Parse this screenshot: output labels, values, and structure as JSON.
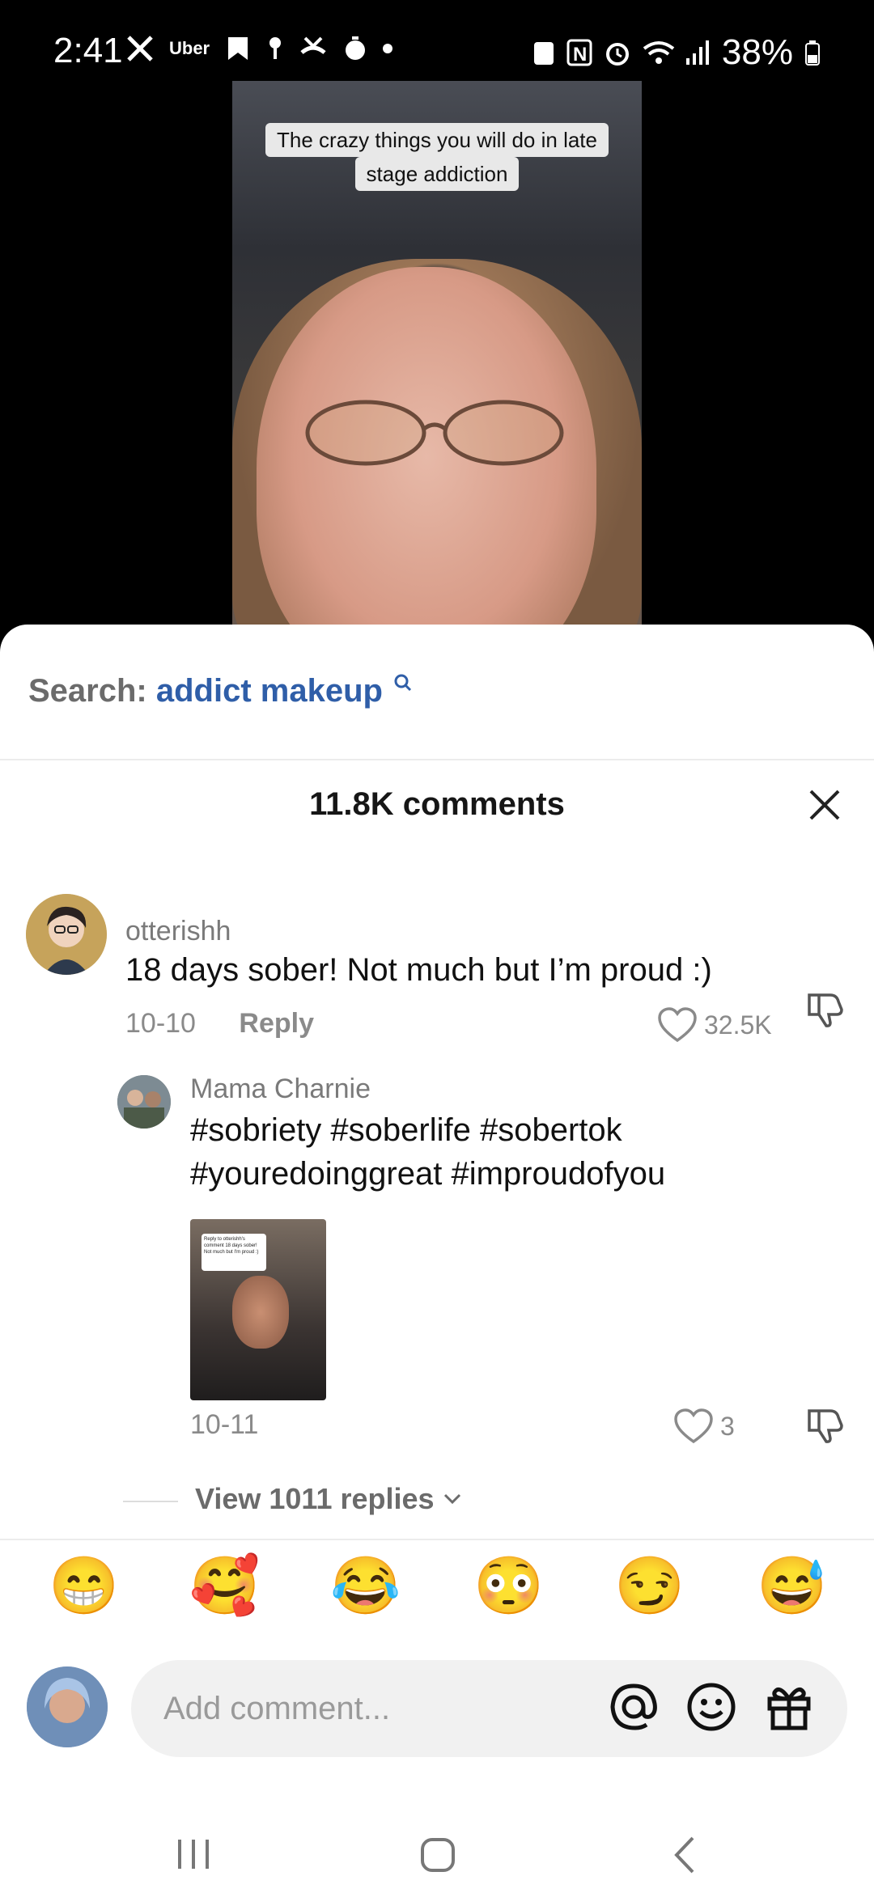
{
  "status_bar": {
    "time": "2:41",
    "uber_label": "Uber",
    "battery": "38%"
  },
  "video": {
    "caption_line1": "The crazy things you will do in late",
    "caption_line2": "stage addiction"
  },
  "search": {
    "label": "Search:",
    "term": "addict makeup"
  },
  "comments": {
    "title": "11.8K comments",
    "main": {
      "username": "otterishh",
      "text": "18 days sober! Not much but I’m proud :)",
      "date": "10-10",
      "reply_label": "Reply",
      "likes": "32.5K"
    },
    "reply": {
      "username": "Mama Charnie",
      "text_line1": "#sobriety #soberlife #sobertok",
      "text_line2": "#youredoinggreat #improudofyou",
      "thumb_caption": "Reply to otterishh's comment 18 days sober! Not much but I'm proud :)",
      "date": "10-11",
      "likes": "3"
    },
    "view_replies": "View 1011 replies"
  },
  "emoji_bar": [
    "😁",
    "🥰",
    "😂",
    "😳",
    "😏",
    "😅"
  ],
  "composer": {
    "placeholder": "Add comment..."
  },
  "colors": {
    "link_blue": "#2f5ea8",
    "muted_text": "#8a8a8a"
  }
}
